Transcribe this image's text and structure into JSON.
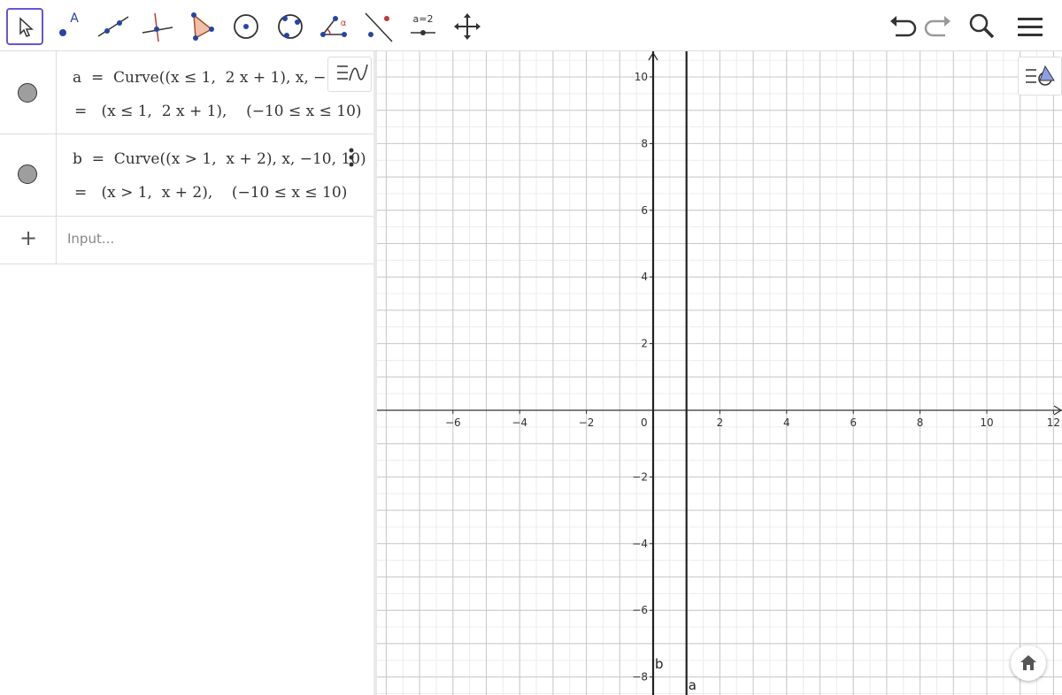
{
  "toolbar": {
    "tools": [
      {
        "name": "move-tool",
        "label": ""
      },
      {
        "name": "point-tool",
        "label": "A"
      },
      {
        "name": "line-tool",
        "label": ""
      },
      {
        "name": "perpendicular-tool",
        "label": ""
      },
      {
        "name": "polygon-tool",
        "label": ""
      },
      {
        "name": "circle-center-tool",
        "label": ""
      },
      {
        "name": "circle-three-points-tool",
        "label": ""
      },
      {
        "name": "angle-tool",
        "label": "α"
      },
      {
        "name": "reflect-tool",
        "label": ""
      },
      {
        "name": "slider-tool",
        "label": "a=2"
      },
      {
        "name": "move-view-tool",
        "label": ""
      }
    ],
    "right_icons": [
      "undo-icon",
      "redo-icon",
      "search-icon",
      "menu-icon"
    ]
  },
  "algebra": {
    "items": [
      {
        "definition": "a  =  Curve((x ≤ 1,  2 x + 1), x, −10,",
        "value": "=   (x ≤ 1,  2 x + 1),    (−10 ≤ x ≤ 10)"
      },
      {
        "definition": "b  =  Curve((x > 1,  x + 2), x, −10, 10)",
        "value": "=   (x > 1,  x + 2),    (−10 ≤ x ≤ 10)"
      }
    ],
    "input_placeholder": "Input..."
  },
  "graph": {
    "x_ticks": [
      "−6",
      "−4",
      "−2",
      "0",
      "2",
      "4",
      "6",
      "8",
      "10",
      "12"
    ],
    "y_ticks": [
      "10",
      "8",
      "6",
      "4",
      "2",
      "−2",
      "−4",
      "−6",
      "−8"
    ],
    "curve_labels": [
      "b",
      "a"
    ]
  },
  "colors": {
    "accent": "#6557d2",
    "grid_major": "#c8c8c8",
    "grid_minor": "#ececec",
    "axis": "#333333"
  }
}
